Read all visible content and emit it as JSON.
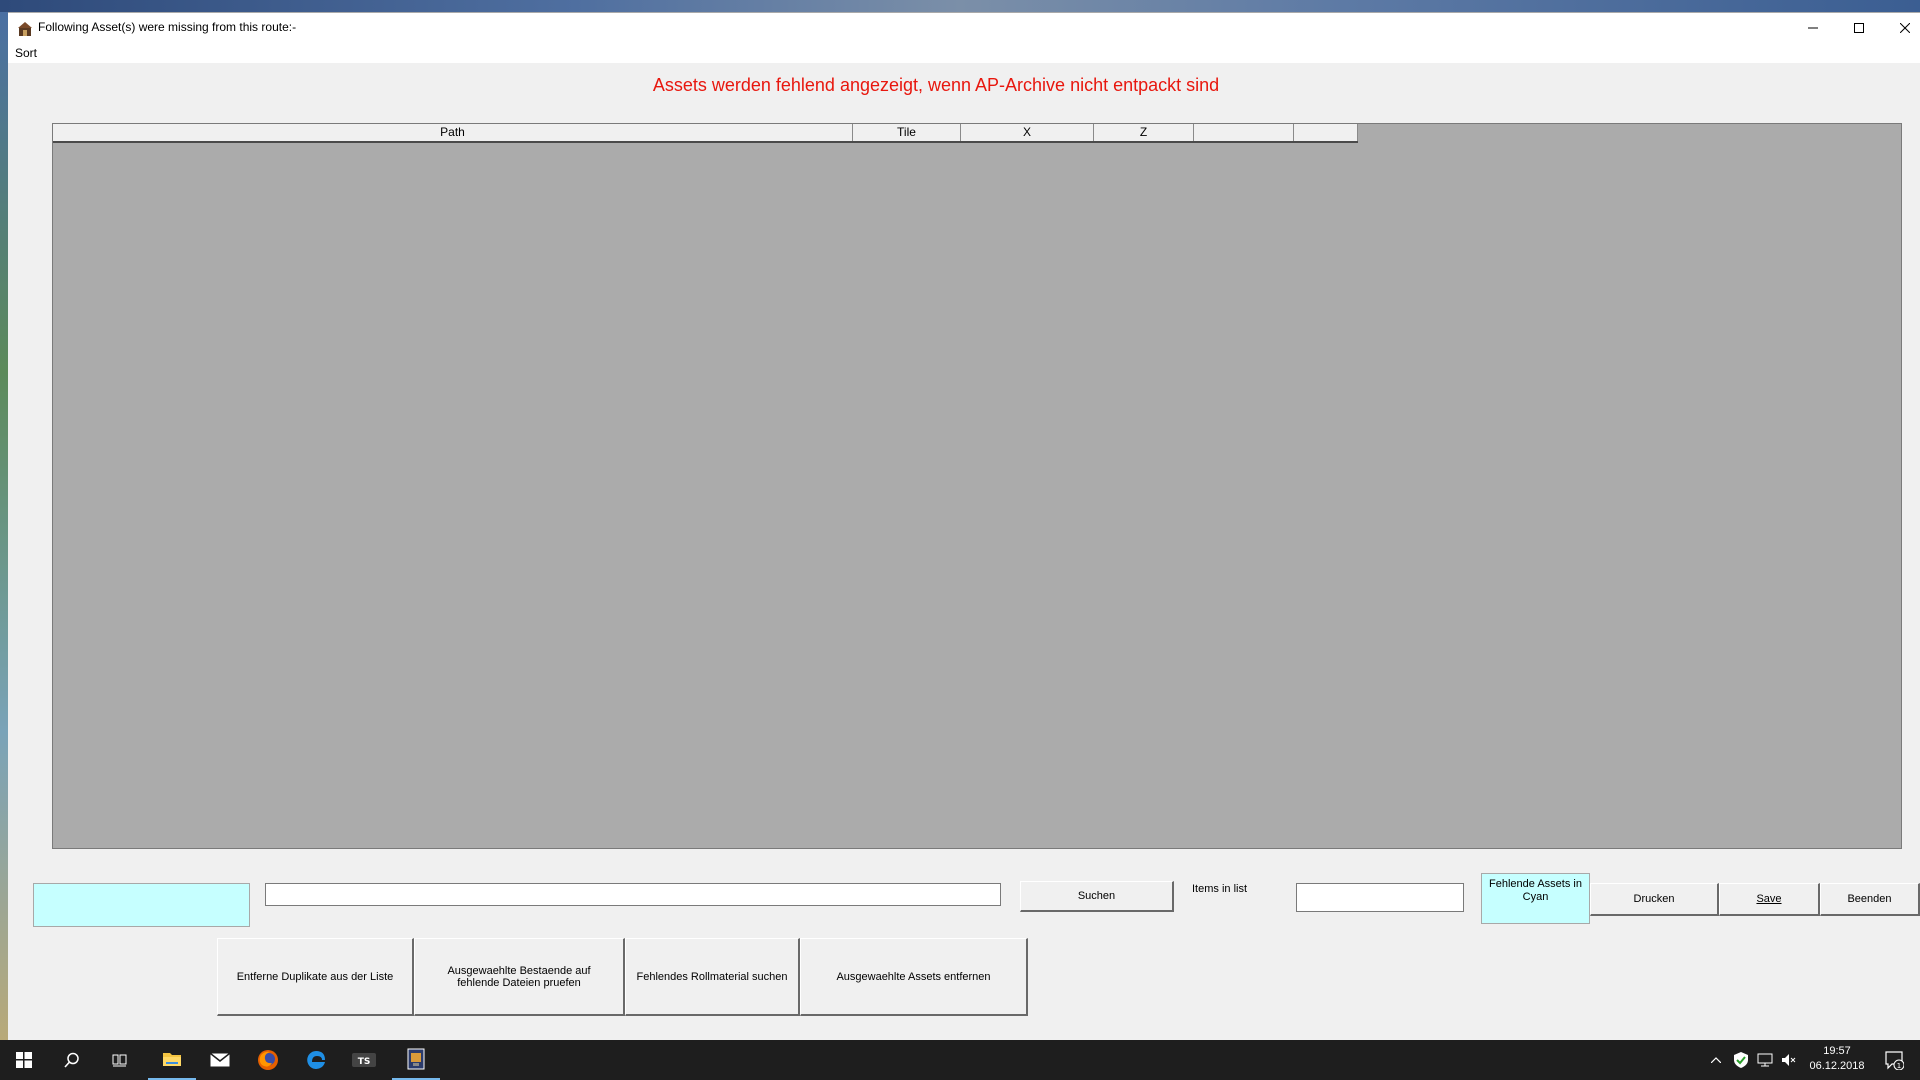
{
  "window": {
    "title": "Following Asset(s) were missing from this route:-",
    "minimize_glyph": "—",
    "maximize_glyph": "☐",
    "close_glyph": "✕"
  },
  "menu": {
    "sort_label": "Sort"
  },
  "notice": "Assets werden fehlend angezeigt, wenn AP-Archive nicht entpackt sind",
  "grid": {
    "columns": [
      "Path",
      "Tile",
      "X",
      "Z",
      "",
      ""
    ],
    "rows": []
  },
  "search": {
    "value": "",
    "button_label": "Suchen"
  },
  "items_in_list_label": "Items in list",
  "items_count": "",
  "legend_label": "Fehlende Assets in Cyan",
  "buttons": {
    "print": "Drucken",
    "save": "Save",
    "exit": "Beenden",
    "remove_duplicates": "Entferne Duplikate aus der Liste",
    "check_selected": "Ausgewaehlte Bestaende auf fehlende Dateien pruefen",
    "find_rolling_stock": "Fehlendes Rollmaterial suchen",
    "remove_selected": "Ausgewaehlte Assets entfernen"
  },
  "colors": {
    "notice_red": "#e8170e",
    "cyan": "#c6ffff",
    "grid_background": "#ababab",
    "taskbar": "#1e1e1e"
  },
  "taskbar": {
    "icons": [
      "windows-start-icon",
      "search-icon",
      "task-view-icon",
      "file-explorer-icon",
      "mail-icon",
      "firefox-icon",
      "edge-icon",
      "train-simulator-icon",
      "route-tool-icon"
    ],
    "tray_icons": [
      "chevron-up-icon",
      "defender-icon",
      "network-icon",
      "volume-muted-icon",
      "action-center-icon"
    ],
    "time": "19:57",
    "date": "06.12.2018",
    "notification_count": "1"
  }
}
